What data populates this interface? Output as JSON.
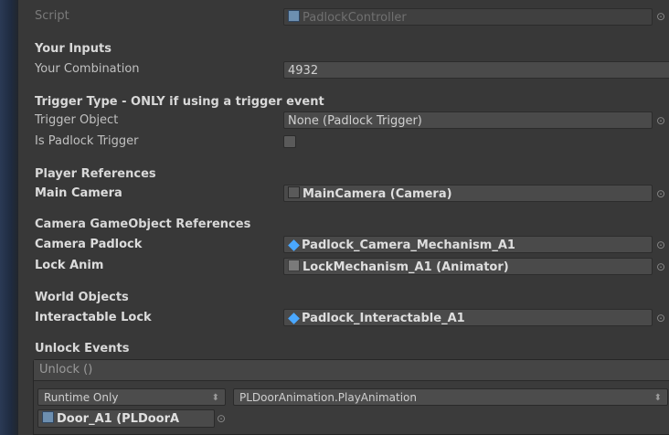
{
  "script_row": {
    "label": "Script",
    "value": "PadlockController",
    "icon": "script-icon"
  },
  "your_inputs": {
    "header": "Your Inputs",
    "combination_label": "Your Combination",
    "combination_value": "4932"
  },
  "trigger_type": {
    "header": "Trigger Type - ONLY if using a trigger event",
    "trigger_object_label": "Trigger Object",
    "trigger_object_value": "None (Padlock Trigger)",
    "is_trigger_label": "Is Padlock Trigger",
    "is_trigger_checked": false
  },
  "player_refs": {
    "header": "Player References",
    "main_camera_label": "Main Camera",
    "main_camera_value": "MainCamera (Camera)"
  },
  "camera_refs": {
    "header": "Camera GameObject References",
    "camera_padlock_label": "Camera Padlock",
    "camera_padlock_value": "Padlock_Camera_Mechanism_A1",
    "lock_anim_label": "Lock Anim",
    "lock_anim_value": "LockMechanism_A1 (Animator)"
  },
  "world_objects": {
    "header": "World Objects",
    "interactable_lock_label": "Interactable Lock",
    "interactable_lock_value": "Padlock_Interactable_A1"
  },
  "unlock_events": {
    "header": "Unlock Events",
    "event_title": "Unlock ()",
    "runtime_option": "Runtime Only",
    "function_option": "PLDoorAnimation.PlayAnimation",
    "target_object": "Door_A1 (PLDoorA"
  },
  "colors": {
    "background": "#383838",
    "accent_blue": "#4aa8ff"
  }
}
